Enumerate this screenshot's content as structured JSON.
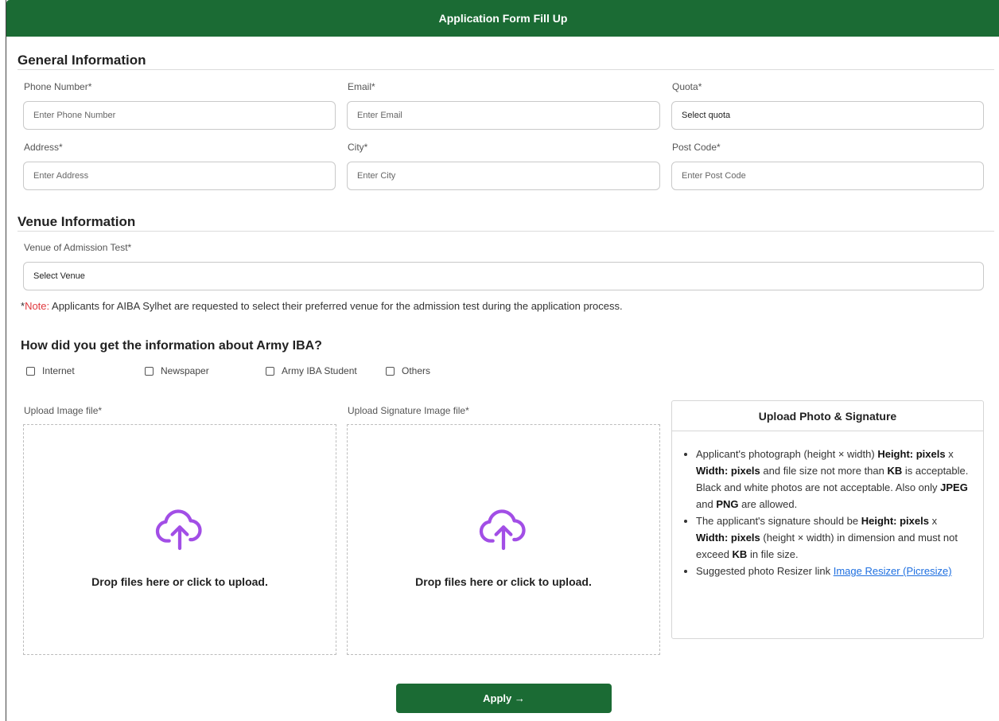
{
  "header": {
    "title": "Application Form Fill Up"
  },
  "general": {
    "title": "General Information",
    "fields": [
      {
        "label": "Phone Number*",
        "placeholder": "Enter Phone Number"
      },
      {
        "label": "Email*",
        "placeholder": "Enter Email"
      },
      {
        "label": "Quota*",
        "value": "Select quota"
      },
      {
        "label": "Address*",
        "placeholder": "Enter Address"
      },
      {
        "label": "City*",
        "placeholder": "Enter City"
      },
      {
        "label": "Post Code*",
        "placeholder": "Enter Post Code"
      }
    ]
  },
  "venue": {
    "title": "Venue Information",
    "label": "Venue of Admission Test*",
    "value": "Select Venue",
    "note_prefix": "*",
    "note_red": "Note:",
    "note_text": " Applicants for AIBA Sylhet are requested to select their preferred venue for the admission test during the application process."
  },
  "source": {
    "question": "How did you get the information about Army IBA?",
    "options": [
      "Internet",
      "Newspaper",
      "Army IBA Student",
      "Others"
    ]
  },
  "upload": {
    "image_label": "Upload Image file*",
    "signature_label": "Upload Signature Image file*",
    "drop_text": "Drop files here or click to upload."
  },
  "info": {
    "title": "Upload Photo & Signature",
    "b1_a": "Applicant's photograph (height × width) ",
    "b1_b": "Height: pixels",
    "b1_c": " x ",
    "b1_d": "Width: pixels",
    "b1_e": " and file size not more than ",
    "b1_f": "KB",
    "b1_g": " is acceptable. Black and white photos are not acceptable. Also only ",
    "b1_h": "JPEG",
    "b1_i": " and ",
    "b1_j": "PNG",
    "b1_k": " are allowed.",
    "b2_a": "The applicant's signature should be ",
    "b2_b": "Height: pixels",
    "b2_c": " x ",
    "b2_d": "Width: pixels",
    "b2_e": " (height × width) in dimension and must not exceed ",
    "b2_f": "KB",
    "b2_g": " in file size.",
    "b3_a": "Suggested photo Resizer link ",
    "b3_link": "Image Resizer (Picresize)"
  },
  "apply": {
    "label": "Apply →"
  },
  "colors": {
    "primary": "#1b6b34",
    "icon": "#a24ee6",
    "note": "#e0393e",
    "link": "#1e6fe0"
  },
  "icons": {
    "upload": "cloud-upload-icon"
  }
}
